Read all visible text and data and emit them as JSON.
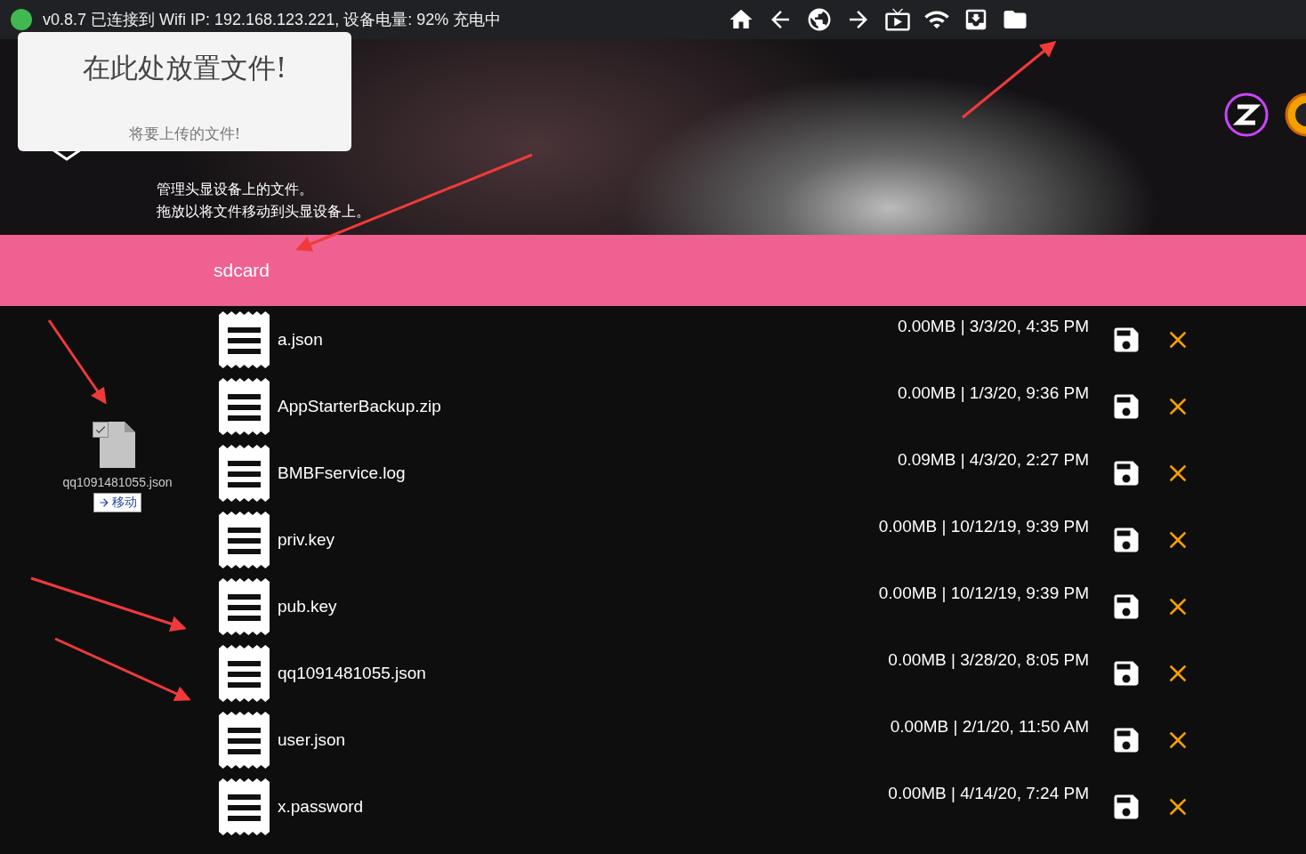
{
  "status_bar": {
    "connected": true,
    "text": "v0.8.7 已连接到 Wifi IP: 192.168.123.221, 设备电量: 92% 充电中"
  },
  "drop_zone": {
    "title": "在此处放置文件!",
    "subtitle": "将要上传的文件!"
  },
  "header": {
    "description": [
      "管理头显设备上的文件。",
      "拖放以将文件移动到头显设备上。"
    ]
  },
  "path": "sdcard",
  "files": [
    {
      "name": "a.json",
      "meta": "0.00MB | 3/3/20, 4:35 PM"
    },
    {
      "name": "AppStarterBackup.zip",
      "meta": "0.00MB | 1/3/20, 9:36 PM"
    },
    {
      "name": "BMBFservice.log",
      "meta": "0.09MB | 4/3/20, 2:27 PM"
    },
    {
      "name": "priv.key",
      "meta": "0.00MB | 10/12/19, 9:39 PM"
    },
    {
      "name": "pub.key",
      "meta": "0.00MB | 10/12/19, 9:39 PM"
    },
    {
      "name": "qq1091481055.json",
      "meta": "0.00MB | 3/28/20, 8:05 PM"
    },
    {
      "name": "user.json",
      "meta": "0.00MB | 2/1/20, 11:50 AM"
    },
    {
      "name": "x.password",
      "meta": "0.00MB | 4/14/20, 7:24 PM"
    }
  ],
  "drag_ghost": {
    "name": "qq1091481055.json",
    "checked": true,
    "action": "移动"
  }
}
